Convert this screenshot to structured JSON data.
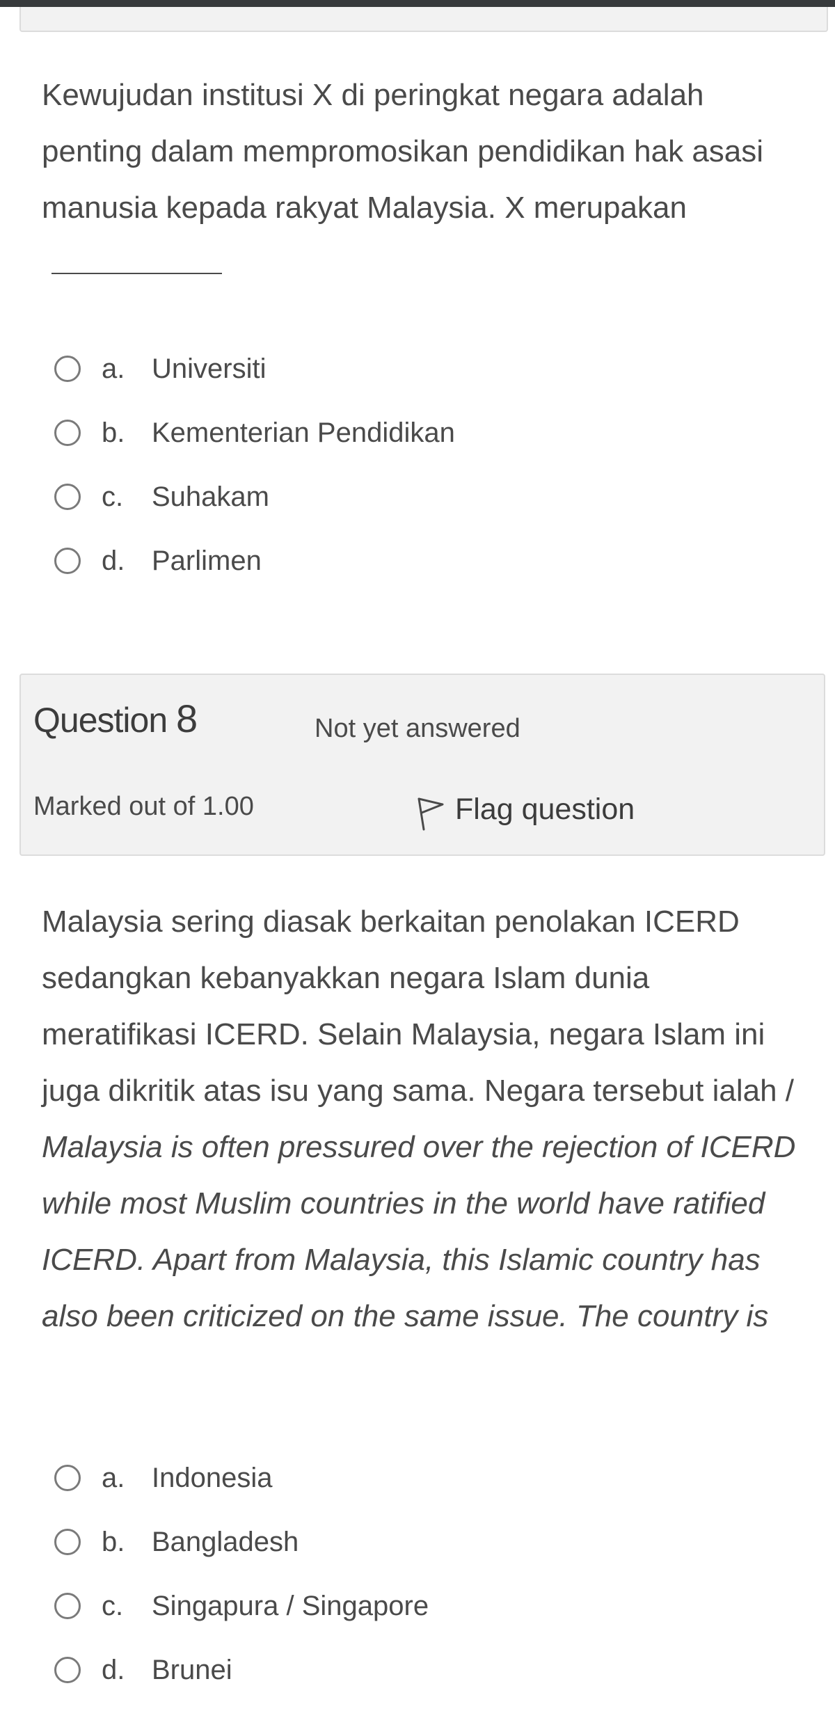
{
  "previous_question": {
    "text": "Kewujudan institusi X di peringkat negara adalah penting dalam mempromosikan pendidikan hak asasi manusia kepada rakyat Malaysia. X merupakan",
    "options": [
      {
        "letter": "a.",
        "text": "Universiti"
      },
      {
        "letter": "b.",
        "text": "Kementerian Pendidikan"
      },
      {
        "letter": "c.",
        "text": "Suhakam"
      },
      {
        "letter": "d.",
        "text": "Parlimen"
      }
    ]
  },
  "question_info": {
    "label": "Question",
    "number": "8",
    "state": "Not yet answered",
    "grade": "Marked out of 1.00",
    "flag_label": "Flag question",
    "flag_icon": "flag-outline-icon"
  },
  "current_question": {
    "text_malay": "Malaysia sering diasak berkaitan penolakan ICERD sedangkan kebanyakkan negara Islam dunia meratifikasi ICERD. Selain Malaysia, negara Islam ini juga dikritik atas isu yang sama. Negara tersebut ialah /",
    "text_english": "Malaysia is often pressured over the rejection of ICERD while most Muslim countries in the world have ratified ICERD. Apart from Malaysia, this Islamic country has also been criticized on the same issue. The country is",
    "options": [
      {
        "letter": "a.",
        "text": "Indonesia"
      },
      {
        "letter": "b.",
        "text": "Bangladesh"
      },
      {
        "letter": "c.",
        "text": "Singapura / Singapore"
      },
      {
        "letter": "d.",
        "text": "Brunei"
      }
    ]
  }
}
